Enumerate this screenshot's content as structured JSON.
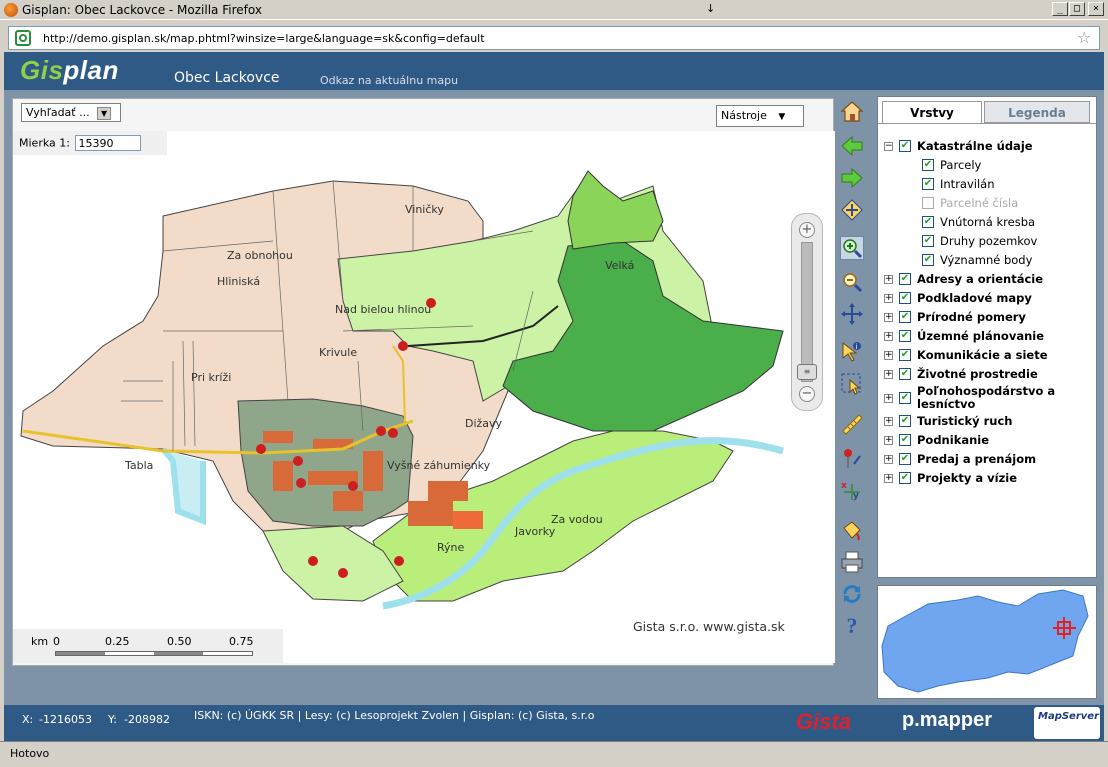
{
  "window": {
    "title": "Gisplan: Obec Lackovce - Mozilla Firefox"
  },
  "browser": {
    "url": "http://demo.gisplan.sk/map.phtml?winsize=large&language=sk&config=default",
    "status": "Hotovo"
  },
  "header": {
    "logo": "Gisplan",
    "title": "Obec Lackovce",
    "link": "Odkaz na aktuálnu mapu"
  },
  "search": {
    "label": "Vyhľadať ..."
  },
  "tools": {
    "label": "Nástroje"
  },
  "scale": {
    "label": "Mierka 1:",
    "value": "15390"
  },
  "map": {
    "copyright": "Gista s.r.o. www.gista.sk",
    "places": [
      "Viničky",
      "Za obnohou",
      "Hliniská",
      "Velká",
      "Nad bielou hlinou",
      "Krivule",
      "Pri kríži",
      "Dižavy",
      "Tabla",
      "Vyšné záhumienky",
      "Za vodou",
      "Javorky",
      "Rýne"
    ]
  },
  "scalebar": {
    "unit": "km",
    "ticks": [
      "0",
      "0.25",
      "0.50",
      "0.75"
    ]
  },
  "panel": {
    "tabs": [
      "Vrstvy",
      "Legenda"
    ],
    "active_tab": "Vrstvy",
    "groups": [
      {
        "label": "Katastrálne údaje",
        "checked": true,
        "expanded": true,
        "children": [
          {
            "label": "Parcely",
            "checked": true,
            "disabled": false
          },
          {
            "label": "Intravilán",
            "checked": true,
            "disabled": false
          },
          {
            "label": "Parcelné čísla",
            "checked": false,
            "disabled": true
          },
          {
            "label": "Vnútorná kresba",
            "checked": true,
            "disabled": false
          },
          {
            "label": "Druhy pozemkov",
            "checked": true,
            "disabled": false
          },
          {
            "label": "Významné body",
            "checked": true,
            "disabled": false
          }
        ]
      },
      {
        "label": "Adresy a orientácie",
        "checked": true
      },
      {
        "label": "Podkladové mapy",
        "checked": true
      },
      {
        "label": "Prírodné pomery",
        "checked": true
      },
      {
        "label": "Územné plánovanie",
        "checked": true
      },
      {
        "label": "Komunikácie a siete",
        "checked": true
      },
      {
        "label": "Životné prostredie",
        "checked": true
      },
      {
        "label": "Poľnohospodárstvo a lesníctvo",
        "checked": true
      },
      {
        "label": "Turistický ruch",
        "checked": true
      },
      {
        "label": "Podnikanie",
        "checked": true
      },
      {
        "label": "Predaj a prenájom",
        "checked": true
      },
      {
        "label": "Projekty a vízie",
        "checked": true
      }
    ]
  },
  "footer": {
    "x_label": "X:",
    "x_value": "-1216053",
    "y_label": "Y:",
    "y_value": "-208982",
    "credits": "ISKN: (c) ÚGKK SR | Lesy: (c) Lesoprojekt Zvolen | Gisplan: (c) Gista, s.r.o",
    "logo_gista": "Gista",
    "logo_pmapper": "p.mapper",
    "logo_mapserver": "MapServer"
  },
  "colors": {
    "header_bg": "#2e5a85",
    "panel_bg": "#7f93a8",
    "logo_green": "#8dd14b",
    "gista_red": "#e0202a"
  }
}
